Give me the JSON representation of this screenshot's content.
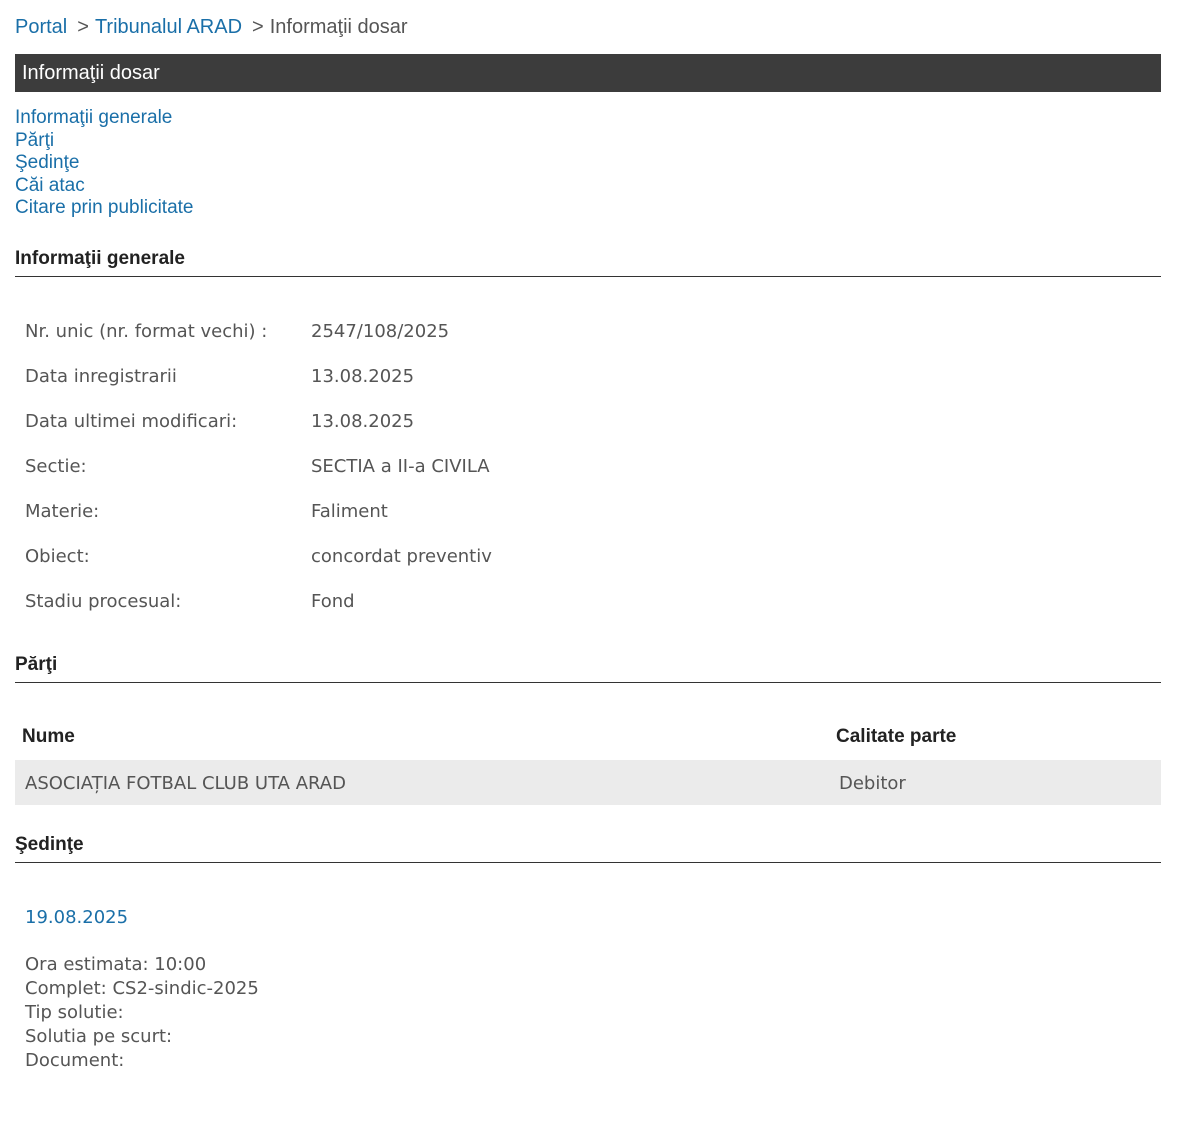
{
  "breadcrumb": {
    "portal": "Portal",
    "court": "Tribunalul ARAD",
    "current": "Informaţii dosar",
    "separator": ">"
  },
  "title_bar": "Informaţii dosar",
  "nav_links": [
    "Informaţii generale",
    "Părţi",
    "Şedinţe",
    "Căi atac",
    "Citare prin publicitate"
  ],
  "sections": {
    "general": "Informaţii generale",
    "parti": "Părţi",
    "sedinte": "Şedinţe"
  },
  "general_info": [
    {
      "label": "Nr. unic (nr. format vechi) :",
      "value": "2547/108/2025"
    },
    {
      "label": "Data inregistrarii",
      "value": "13.08.2025"
    },
    {
      "label": "Data ultimei modificari:",
      "value": "13.08.2025"
    },
    {
      "label": "Sectie:",
      "value": "SECTIA a II-a CIVILA"
    },
    {
      "label": "Materie:",
      "value": "Faliment"
    },
    {
      "label": "Obiect:",
      "value": "concordat preventiv"
    },
    {
      "label": "Stadiu procesual:",
      "value": "Fond"
    }
  ],
  "parti_table": {
    "headers": {
      "name": "Nume",
      "role": "Calitate parte"
    },
    "rows": [
      {
        "name": "ASOCIAȚIA FOTBAL CLUB UTA ARAD",
        "role": "Debitor"
      }
    ]
  },
  "sedinta": {
    "date": "19.08.2025",
    "details": [
      "Ora estimata: 10:00",
      "Complet: CS2-sindic-2025",
      "Tip solutie:",
      "Solutia pe scurt:",
      "Document:"
    ]
  },
  "colors": {
    "link": "#1a6fa8",
    "title_bar_bg": "#3c3c3c",
    "row_bg": "#ebebeb"
  }
}
